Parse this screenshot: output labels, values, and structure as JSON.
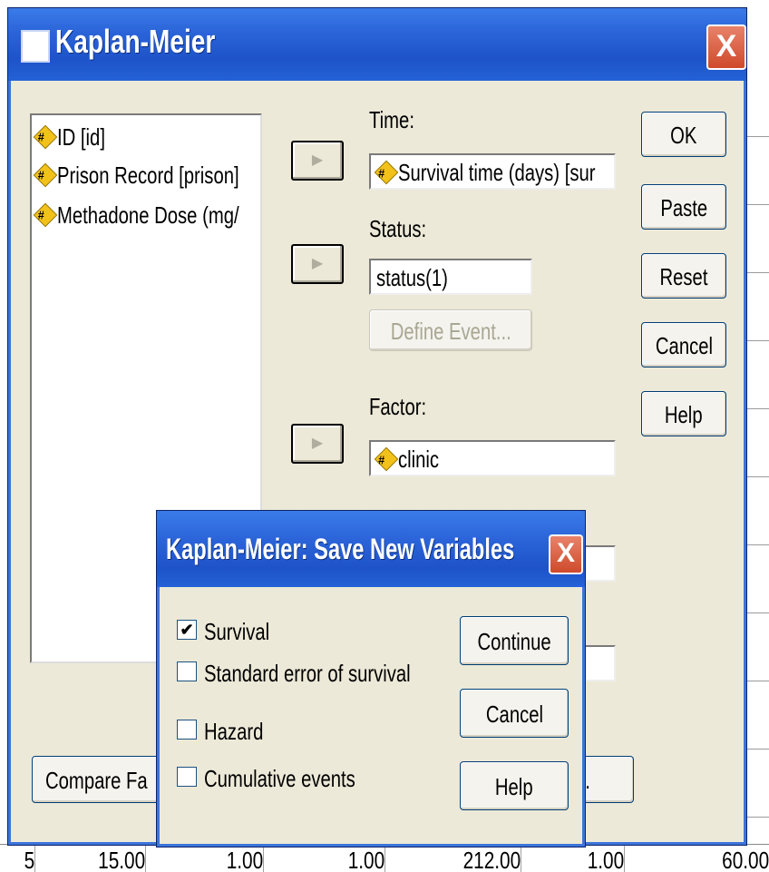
{
  "background": {
    "bottom_row": [
      "5",
      "15.00",
      "1.00",
      "1.00",
      "212.00",
      "1.00",
      "60.00"
    ]
  },
  "main_dialog": {
    "title": "Kaplan-Meier",
    "close_glyph": "X",
    "variables": [
      "ID [id]",
      "Prison Record [prison]",
      "Methadone Dose (mg/"
    ],
    "time_label": "Time:",
    "time_value": "Survival time (days) [sur",
    "status_label": "Status:",
    "status_value": "status(1)",
    "define_event_label": "Define Event...",
    "factor_label": "Factor:",
    "factor_value": "clinic",
    "arrow_glyph": "▶",
    "buttons": {
      "ok": "OK",
      "paste": "Paste",
      "reset": "Reset",
      "cancel": "Cancel",
      "help": "Help"
    },
    "compare_button": "Compare Fa",
    "options_button_partial": "..."
  },
  "save_dialog": {
    "title": "Kaplan-Meier: Save New Variables",
    "close_glyph": "X",
    "options": [
      {
        "label": "Survival",
        "checked": true
      },
      {
        "label": "Standard error of survival",
        "checked": false
      },
      {
        "label": "Hazard",
        "checked": false
      },
      {
        "label": "Cumulative events",
        "checked": false
      }
    ],
    "check_glyph": "✔",
    "buttons": {
      "continue": "Continue",
      "cancel": "Cancel",
      "help": "Help"
    }
  },
  "colors": {
    "titlebar": "#2a63d8",
    "dialog_bg": "#ece9d8",
    "close": "#cf4a2c"
  }
}
